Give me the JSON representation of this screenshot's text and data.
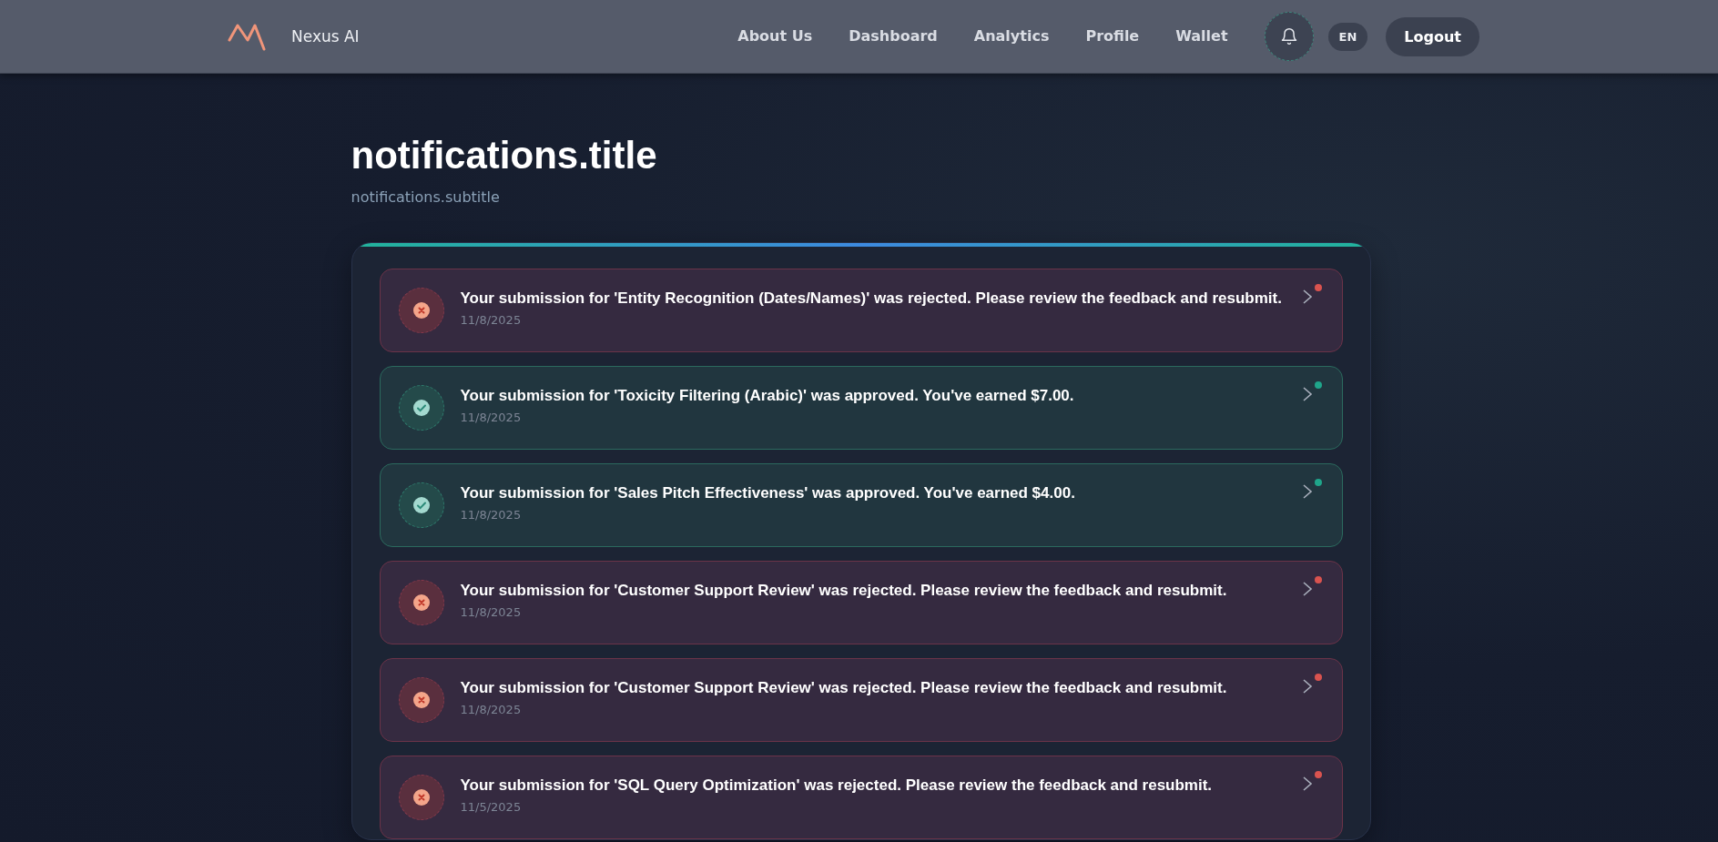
{
  "header": {
    "brand": "Nexus AI",
    "nav": [
      {
        "label": "About Us",
        "selected": false
      },
      {
        "label": "Dashboard",
        "selected": false
      },
      {
        "label": "Analytics",
        "selected": false
      },
      {
        "label": "Profile",
        "selected": false
      },
      {
        "label": "Wallet",
        "selected": false
      }
    ],
    "language": "EN",
    "logout": "Logout"
  },
  "page": {
    "title": "notifications.title",
    "subtitle": "notifications.subtitle"
  },
  "notifications": [
    {
      "kind": "rejected",
      "message": "Your submission for 'Entity Recognition (Dates/Names)' was rejected. Please review the feedback and resubmit.",
      "date": "11/8/2025"
    },
    {
      "kind": "approved",
      "message": "Your submission for 'Toxicity Filtering (Arabic)' was approved. You've earned $7.00.",
      "date": "11/8/2025"
    },
    {
      "kind": "approved",
      "message": "Your submission for 'Sales Pitch Effectiveness' was approved. You've earned $4.00.",
      "date": "11/8/2025"
    },
    {
      "kind": "rejected",
      "message": "Your submission for 'Customer Support Review' was rejected. Please review the feedback and resubmit.",
      "date": "11/8/2025"
    },
    {
      "kind": "rejected",
      "message": "Your submission for 'Customer Support Review' was rejected. Please review the feedback and resubmit.",
      "date": "11/8/2025"
    },
    {
      "kind": "rejected",
      "message": "Your submission for 'SQL Query Optimization' was rejected. Please review the feedback and resubmit.",
      "date": "11/5/2025"
    }
  ]
}
